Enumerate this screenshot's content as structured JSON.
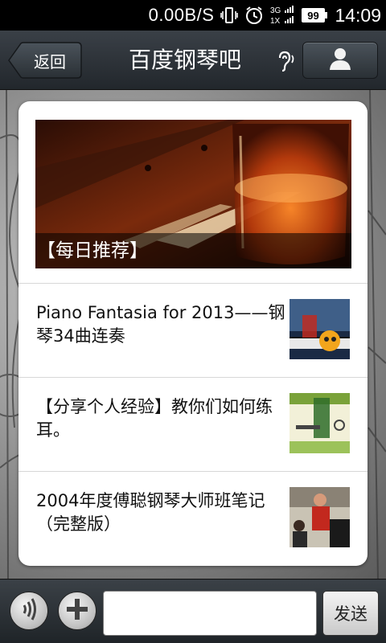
{
  "status_bar": {
    "net_speed": "0.00B/S",
    "network_label_top": "3G",
    "network_label_bottom": "1X",
    "battery": "99",
    "time": "14:09",
    "icons": [
      "vibrate-icon",
      "alarm-icon",
      "signal-icon",
      "battery-icon"
    ]
  },
  "header": {
    "back_label": "返回",
    "title": "百度钢琴吧",
    "ear_icon": "ear-icon",
    "profile_icon": "person-icon"
  },
  "feature": {
    "caption": "【每日推荐】"
  },
  "articles": [
    {
      "title": "Piano Fantasia for 2013——钢琴34曲连奏",
      "thumb": "piano-player-thumb"
    },
    {
      "title": "【分享个人经验】教你们如何练耳。",
      "thumb": "book-cover-thumb"
    },
    {
      "title": "2004年度傅聪钢琴大师班笔记（完整版）",
      "thumb": "master-class-thumb"
    }
  ],
  "input_bar": {
    "message_value": "",
    "send_label": "发送",
    "voice_icon": "voice-icon",
    "plus_icon": "plus-icon"
  },
  "colors": {
    "header_top": "#3a4047",
    "header_bottom": "#22272c",
    "card": "#ffffff"
  }
}
